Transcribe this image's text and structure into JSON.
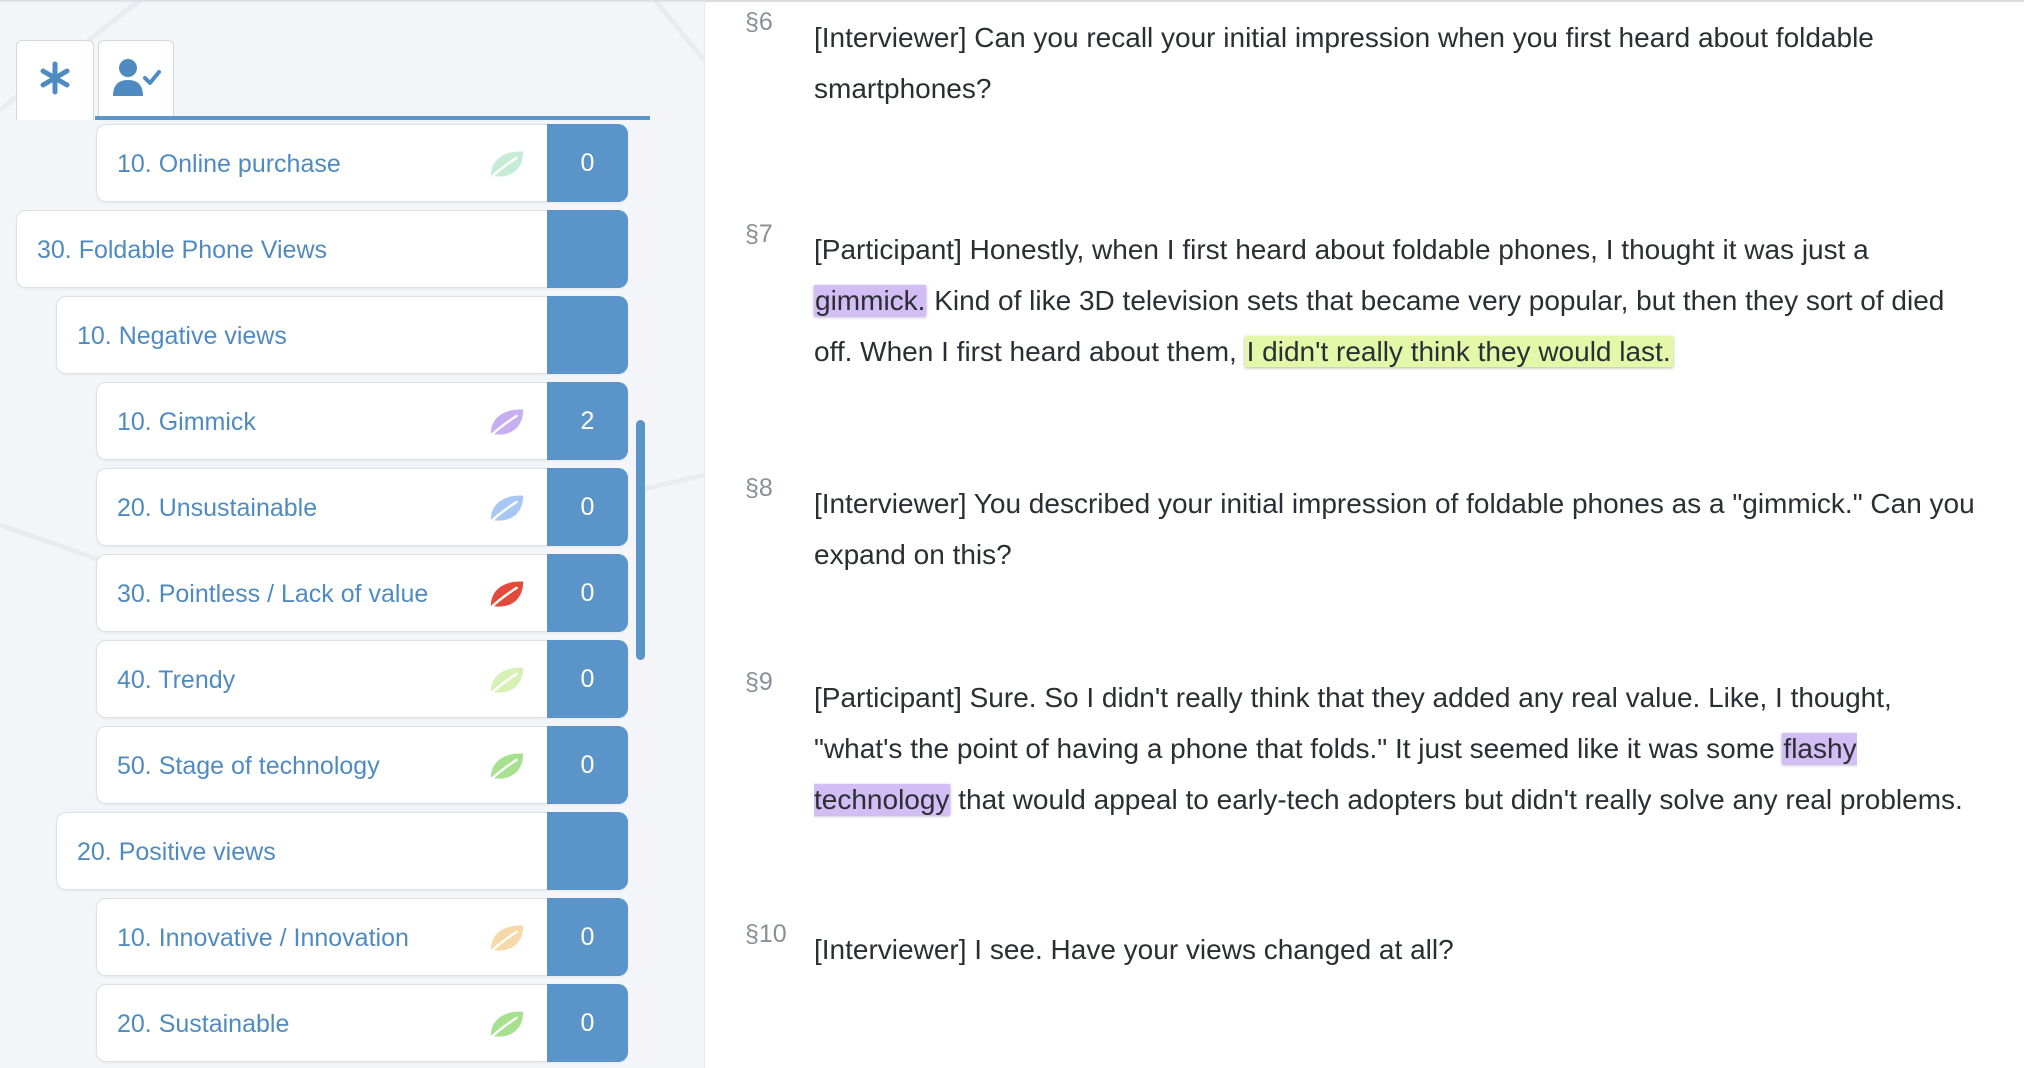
{
  "tabs": [
    {
      "name": "all-codes",
      "icon": "asterisk-icon"
    },
    {
      "name": "my-codes",
      "icon": "user-check-icon"
    }
  ],
  "accent_color": "#5a94c8",
  "codes": [
    {
      "label": "10. Online purchase",
      "count": "0",
      "leaf_color": "#c6ecd6",
      "level": 2
    },
    {
      "label": "30. Foldable Phone Views",
      "count": "",
      "leaf_color": "",
      "level": 0
    },
    {
      "label": "10. Negative views",
      "count": "",
      "leaf_color": "",
      "level": 1
    },
    {
      "label": "10. Gimmick",
      "count": "2",
      "leaf_color": "#c8aef0",
      "level": 2
    },
    {
      "label": "20. Unsustainable",
      "count": "0",
      "leaf_color": "#a8c8f4",
      "level": 2
    },
    {
      "label": "30. Pointless / Lack of value",
      "count": "0",
      "leaf_color": "#e24b3c",
      "level": 2
    },
    {
      "label": "40. Trendy",
      "count": "0",
      "leaf_color": "#d6f0b6",
      "level": 2
    },
    {
      "label": "50. Stage of technology",
      "count": "0",
      "leaf_color": "#a7e08e",
      "level": 2
    },
    {
      "label": "20. Positive views",
      "count": "",
      "leaf_color": "",
      "level": 1
    },
    {
      "label": "10. Innovative / Innovation",
      "count": "0",
      "leaf_color": "#f7d8a8",
      "level": 2
    },
    {
      "label": "20. Sustainable",
      "count": "0",
      "leaf_color": "#a7e08e",
      "level": 2
    }
  ],
  "paragraphs": [
    {
      "num": "§6",
      "segments": [
        {
          "text": "[Interviewer] Can you recall your initial impression when you first heard about foldable smartphones?",
          "hl": ""
        }
      ]
    },
    {
      "num": "§7",
      "segments": [
        {
          "text": "[Participant] Honestly, when I first heard about foldable phones, I thought it was just a ",
          "hl": ""
        },
        {
          "text": "gimmick.",
          "hl": "purple"
        },
        {
          "text": " Kind of like 3D television sets that became very popular, but then they sort of died off. When I first heard about them, ",
          "hl": ""
        },
        {
          "text": "I didn't really think they would last.",
          "hl": "green"
        }
      ]
    },
    {
      "num": "§8",
      "segments": [
        {
          "text": "[Interviewer] You described your initial impression of foldable phones as a \"gimmick.\" Can you expand on this?",
          "hl": ""
        }
      ]
    },
    {
      "num": "§9",
      "segments": [
        {
          "text": "[Participant] Sure. So I didn't really think that they added any real value. Like, I thought, \"what's the point of having a phone that folds.\" It just seemed like it was some ",
          "hl": ""
        },
        {
          "text": "flashy technology",
          "hl": "purple"
        },
        {
          "text": " that would appeal to early-tech adopters but didn't really solve any real problems.",
          "hl": ""
        }
      ]
    },
    {
      "num": "§10",
      "segments": [
        {
          "text": "[Interviewer] I see. Have your views changed at all?",
          "hl": ""
        }
      ]
    }
  ]
}
